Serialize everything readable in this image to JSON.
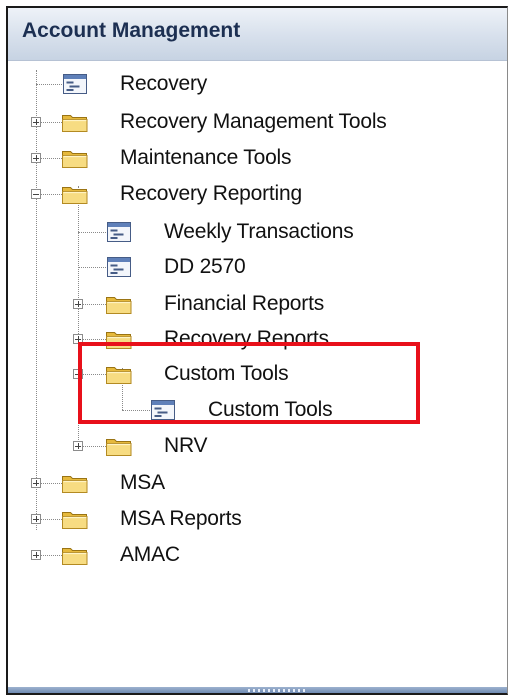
{
  "panel": {
    "title": "Account Management"
  },
  "tree": {
    "recovery": "Recovery",
    "recovery_management_tools": "Recovery Management Tools",
    "maintenance_tools": "Maintenance Tools",
    "recovery_reporting": "Recovery Reporting",
    "weekly_transactions": "Weekly Transactions",
    "dd_2570": "DD 2570",
    "financial_reports": "Financial Reports",
    "recovery_reports": "Recovery Reports",
    "custom_tools_folder": "Custom Tools",
    "custom_tools_item": "Custom Tools",
    "nrv": "NRV",
    "msa": "MSA",
    "msa_reports": "MSA Reports",
    "amac": "AMAC"
  },
  "colors": {
    "highlight": "#e8101a",
    "header_text": "#1c2f52"
  }
}
